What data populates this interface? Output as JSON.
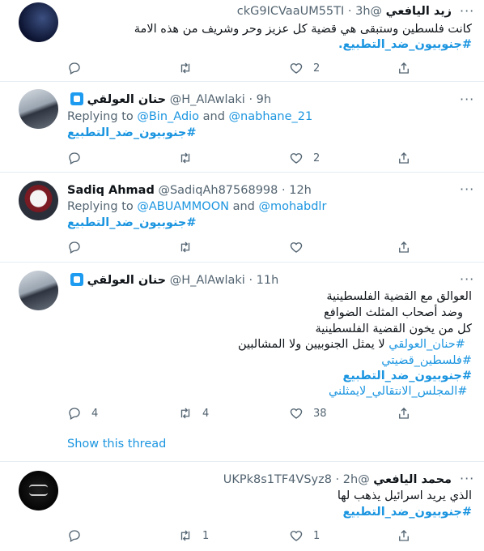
{
  "tweets": [
    {
      "name": "زيد اليافعي",
      "handle": "@ckG9ICVaaUM55TI",
      "time": "3h",
      "lines": [
        "كانت فلسطين وستبقى هي قضية كل عزيز وحر وشريف من هذه الامة",
        "#جنوبيون_ضد_التطبيع."
      ],
      "counts": {
        "reply": "",
        "retweet": "",
        "like": "2",
        "share": ""
      }
    },
    {
      "name": "حنان العولقي",
      "handle": "@H_AlAwlaki",
      "time": "9h",
      "replying_prefix": "Replying to",
      "replying_1": "@Bin_Adio",
      "replying_and": "and",
      "replying_2": "@nabhane_21",
      "tag": "#جنوبيون_ضد_التطبيع",
      "counts": {
        "reply": "",
        "retweet": "",
        "like": "2",
        "share": ""
      }
    },
    {
      "name": "Sadiq Ahmad",
      "handle": "@SadiqAh87568998",
      "time": "12h",
      "replying_prefix": "Replying to",
      "replying_1": "@ABUAMMOON",
      "replying_and": "and",
      "replying_2": "@mohabdlr",
      "tag": "#جنوبيون_ضد_التطبيع",
      "counts": {
        "reply": "",
        "retweet": "",
        "like": "",
        "share": ""
      }
    },
    {
      "name": "حنان العولقي",
      "handle": "@H_AlAwlaki",
      "time": "11h",
      "lines": [
        "العوالق مع القضية الفلسطينية",
        "وضد أصحاب المثلث الضوافع",
        "كل من يخون القضية الفلسطينية",
        "لا يمثل الجنوبيين ولا المشالبين"
      ],
      "inline_tag": "#حنان_العولقي",
      "tags": [
        "#فلسطين_قضيتي",
        "#جنوبيون_ضد_التطبيع",
        "#المجلس_الانتقالي_لايمثلني"
      ],
      "counts": {
        "reply": "4",
        "retweet": "4",
        "like": "38",
        "share": ""
      },
      "show_thread": "Show this thread"
    },
    {
      "name": "محمد اليافعي",
      "handle": "@UKPk8s1TF4VSyz8",
      "time": "2h",
      "lines": [
        "الذي يريد اسرائيل يذهب لها"
      ],
      "tag": "#جنوبيون_ضد_التطبيع",
      "counts": {
        "reply": "",
        "retweet": "1",
        "like": "1",
        "share": ""
      }
    }
  ],
  "separator": "·",
  "colors": {
    "link": "#1b95e0",
    "muted": "#536471",
    "border": "#e6ecf0",
    "verified": "#1d9bf0"
  }
}
